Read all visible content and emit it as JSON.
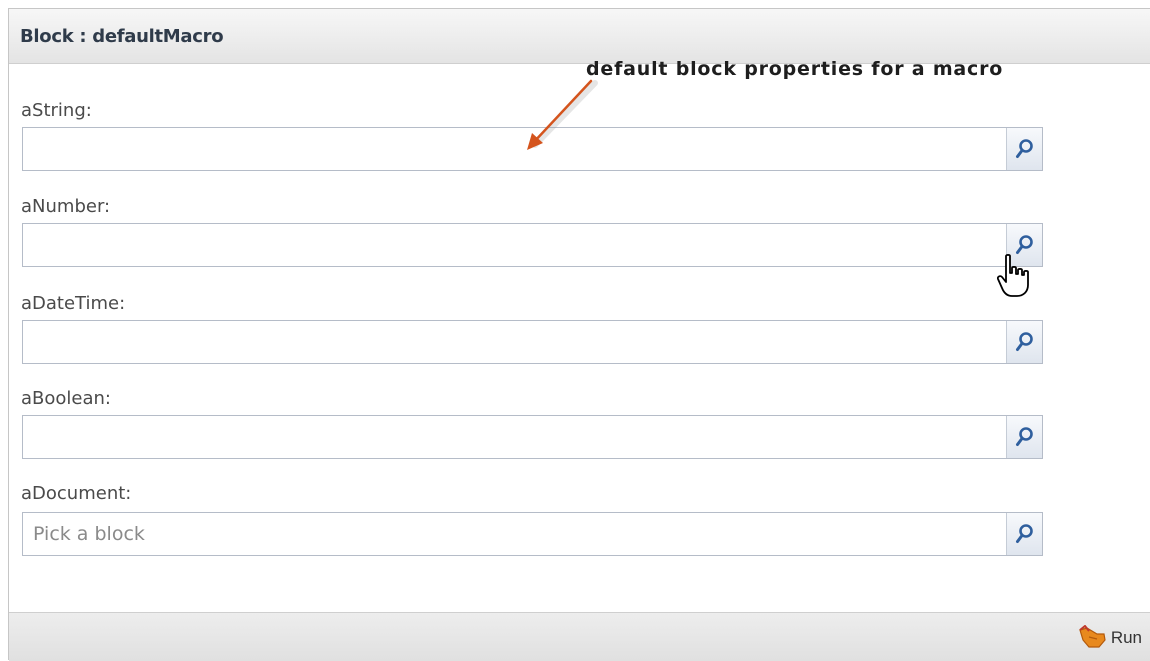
{
  "panel": {
    "title": "Block : defaultMacro"
  },
  "annotation": {
    "text": "default block properties for a macro",
    "arrow_color": "#d4541d"
  },
  "fields": [
    {
      "label": "aString:",
      "value": "",
      "placeholder": ""
    },
    {
      "label": "aNumber:",
      "value": "",
      "placeholder": ""
    },
    {
      "label": "aDateTime:",
      "value": "",
      "placeholder": ""
    },
    {
      "label": "aBoolean:",
      "value": "",
      "placeholder": ""
    },
    {
      "label": "aDocument:",
      "value": "",
      "placeholder": "Pick a block"
    }
  ],
  "field_button_icon": "search-icon",
  "footer": {
    "run_label": "Run",
    "run_icon": "run-hand-icon"
  },
  "colors": {
    "accent": "#2f5f9e",
    "arrow": "#d4541d",
    "run_icon": "#e8891e"
  }
}
